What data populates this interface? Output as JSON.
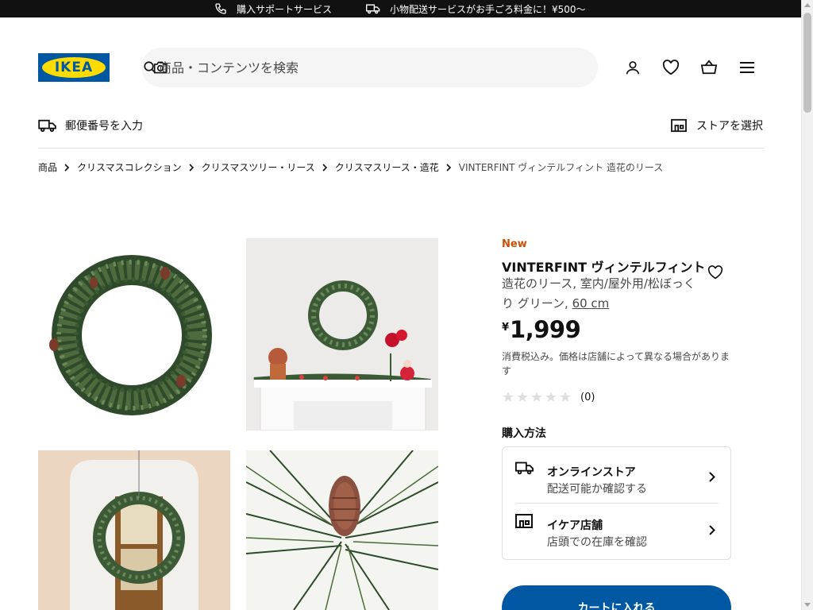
{
  "topbar": {
    "support_label": "購入サポートサービス",
    "delivery_label": "小物配送サービスがお手ごろ料金に！¥500〜",
    "bg_color": "#111111"
  },
  "header": {
    "logo_text": "IKEA",
    "search_placeholder": "商品・コンテンツを検索",
    "icons": [
      "search-icon",
      "camera-icon",
      "user-icon",
      "heart-icon",
      "basket-icon",
      "menu-icon"
    ]
  },
  "location": {
    "postal_label": "郵便番号を入力",
    "store_label": "ストアを選択"
  },
  "breadcrumb": [
    "商品",
    "クリスマスコレクション",
    "クリスマスツリー・リース",
    "クリスマスリース・造花",
    "VINTERFINT ヴィンテルフィント 造花のリース"
  ],
  "product": {
    "badge": "New",
    "name": "VINTERFINT ヴィンテルフィント",
    "desc": "造花のリース, 室内/屋外用/松ぼっくり グリーン,",
    "size": "60 cm",
    "currency": "¥",
    "price": "1,999",
    "tax_note": "消費税込み。価格は店舗によって異なる場合があります",
    "rating_count": "(0)",
    "rating_value": 0,
    "rating_max": 5
  },
  "purchase": {
    "title": "購入方法",
    "online_title": "オンラインストア",
    "online_sub": "配送可能か確認する",
    "store_title": "イケア店舗",
    "store_sub": "店頭での在庫を確認",
    "cart_button": "カートに入れる"
  },
  "colors": {
    "brand_blue": "#0058a3",
    "brand_yellow": "#ffdb00",
    "new_badge": "#ca5008"
  }
}
